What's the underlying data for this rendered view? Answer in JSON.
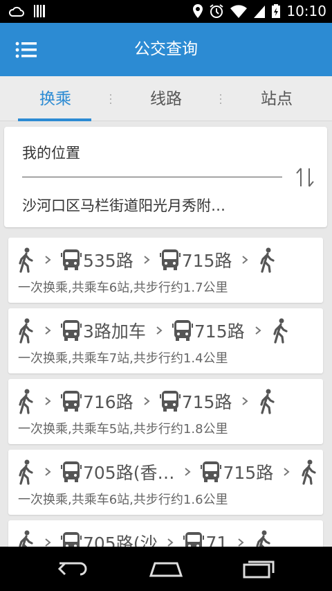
{
  "status_bar": {
    "time": "10:10",
    "icons": [
      "cloud-icon",
      "barcode-icon",
      "location-pin-icon",
      "alarm-icon",
      "wifi-icon",
      "signal-icon",
      "battery-icon"
    ]
  },
  "app_bar": {
    "title": "公交查询",
    "menu_icon": "menu-list-icon"
  },
  "tabs": [
    {
      "label": "换乘",
      "active": true
    },
    {
      "label": "线路",
      "active": false
    },
    {
      "label": "站点",
      "active": false
    }
  ],
  "location": {
    "from": "我的位置",
    "to": "沙河口区马栏街道阳光月秀附…",
    "swap_icon": "swap-arrows-icon"
  },
  "routes": [
    {
      "lines": [
        "535路",
        "715路"
      ],
      "summary": "一次换乘,共乘车6站,共步行约1.7公里"
    },
    {
      "lines": [
        "3路加车",
        "715路"
      ],
      "summary": "一次换乘,共乘车7站,共步行约1.4公里"
    },
    {
      "lines": [
        "716路",
        "715路"
      ],
      "summary": "一次换乘,共乘车5站,共步行约1.8公里"
    },
    {
      "lines": [
        "705路(香…",
        "715路"
      ],
      "summary": "一次换乘,共乘车6站,共步行约1.6公里"
    },
    {
      "lines": [
        "705路(沙",
        "71"
      ],
      "summary": ""
    }
  ],
  "nav_bar": {
    "icons": [
      "back-icon",
      "home-icon",
      "recents-icon"
    ]
  },
  "colors": {
    "primary": "#2c8bd3",
    "background": "#e8e8e8",
    "card": "#ffffff",
    "text": "#555555"
  }
}
